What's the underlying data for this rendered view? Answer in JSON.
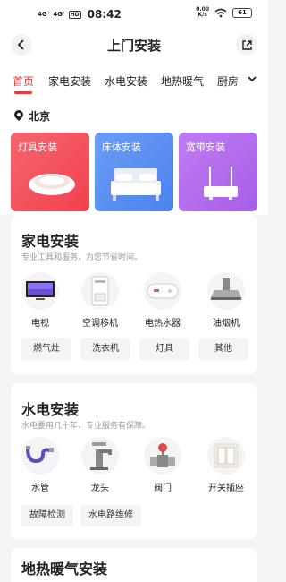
{
  "status_bar": {
    "signal1": "4G⁺",
    "signal2": "4G⁺",
    "hd": "HD",
    "time": "08:42",
    "net_speed": "0.00",
    "net_unit": "K/s",
    "battery": "61"
  },
  "header": {
    "title": "上门安装",
    "back_icon": "back-arrow-icon",
    "share_icon": "share-icon"
  },
  "tabs": [
    "首页",
    "家电安装",
    "水电安装",
    "地热暖气",
    "厨房"
  ],
  "active_tab": "首页",
  "location": {
    "city": "北京"
  },
  "banners": [
    {
      "title": "灯具安装",
      "color": "#f4505d"
    },
    {
      "title": "床体安装",
      "color": "#5a8ef2"
    },
    {
      "title": "宽带安装",
      "color": "#b36ef0"
    }
  ],
  "sections": [
    {
      "title": "家电安装",
      "subtitle": "专业工具和服务，为您节省时间。",
      "items": [
        "电视",
        "空调移机",
        "电热水器",
        "油烟机"
      ],
      "chips": [
        "燃气灶",
        "洗衣机",
        "灯具",
        "其他"
      ]
    },
    {
      "title": "水电安装",
      "subtitle": "水电要用几十年，专业服务有保障。",
      "items": [
        "水管",
        "龙头",
        "阀门",
        "开关插座"
      ],
      "chips": [
        "故障检测",
        "水电路维修"
      ]
    },
    {
      "title": "地热暖气安装"
    }
  ],
  "colors": {
    "accent": "#e93b3b"
  }
}
